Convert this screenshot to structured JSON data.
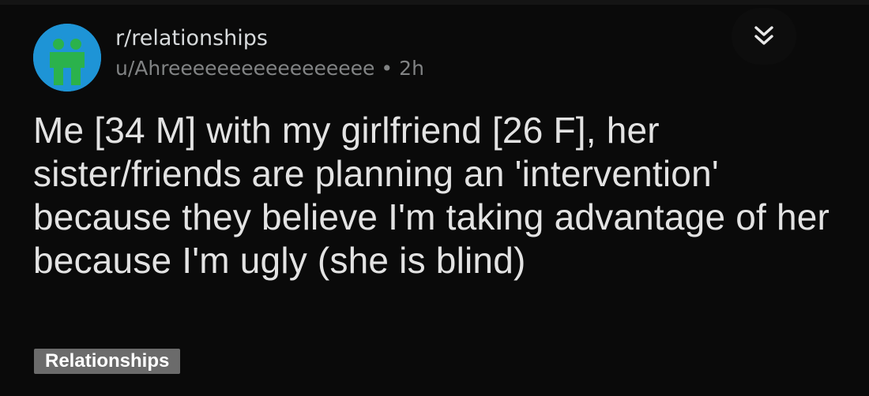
{
  "post": {
    "subreddit": "r/relationships",
    "author": "u/Ahreeeeeeeeeeeeeeeee",
    "separator": "•",
    "age": "2h",
    "title": "Me [34 M] with my girlfriend [26 F], her sister/friends are planning an 'intervention' because they believe I'm taking advantage of her because I'm ugly (she is blind)",
    "flair": "Relationships"
  },
  "icons": {
    "avatar": "subreddit-couple-icon",
    "collapse": "double-chevron-down-icon"
  },
  "colors": {
    "background": "#0a0a0a",
    "avatar_bg": "#1e94d6",
    "avatar_figures": "#2bb24c",
    "text_primary": "#d7dadc",
    "text_muted": "#818384",
    "flair_bg": "#6b6b6b"
  }
}
